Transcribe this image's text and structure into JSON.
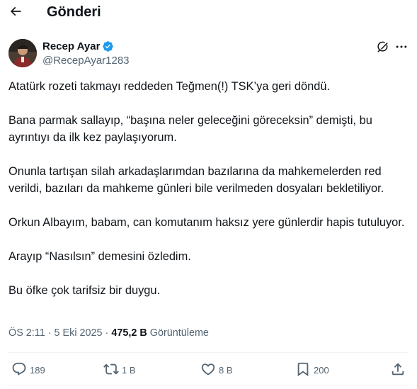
{
  "header": {
    "title": "Gönderi",
    "back_icon": "arrow-left-icon"
  },
  "author": {
    "name": "Recep Ayar",
    "handle": "@RecepAyar1283",
    "verified": true,
    "verified_color": "#1d9bf0"
  },
  "tweet": {
    "paragraphs": [
      "Atatürk rozeti takmayı reddeden Teğmen(!) TSK’ya geri döndü.",
      "Bana parmak sallayıp, “başına neler geleceğini göreceksin” demişti, bu ayrıntıyı da ilk kez paylaşıyorum.",
      "Onunla tartışan silah arkadaşlarımdan bazılarına da mahkemelerden red verildi, bazıları da mahkeme günleri bile verilmeden dosyaları bekletiliyor.",
      "Orkun Albayım, babam, can komutanım haksız yere günlerdir hapis tutuluyor.",
      "Arayıp “Nasılsın” demesini özledim.",
      "Bu öfke çok tarifsiz bir duygu."
    ]
  },
  "meta": {
    "time": "ÖS 2:11",
    "date": "5 Eki 2025",
    "separator": "·",
    "views": "475,2 B",
    "views_label": "Görüntüleme"
  },
  "actions": {
    "reply": "189",
    "retweet": "1 B",
    "like": "8 B",
    "bookmark": "200"
  },
  "colors": {
    "text": "#0f1419",
    "secondary": "#536471",
    "divider": "#eff3f4",
    "accent": "#1d9bf0"
  }
}
